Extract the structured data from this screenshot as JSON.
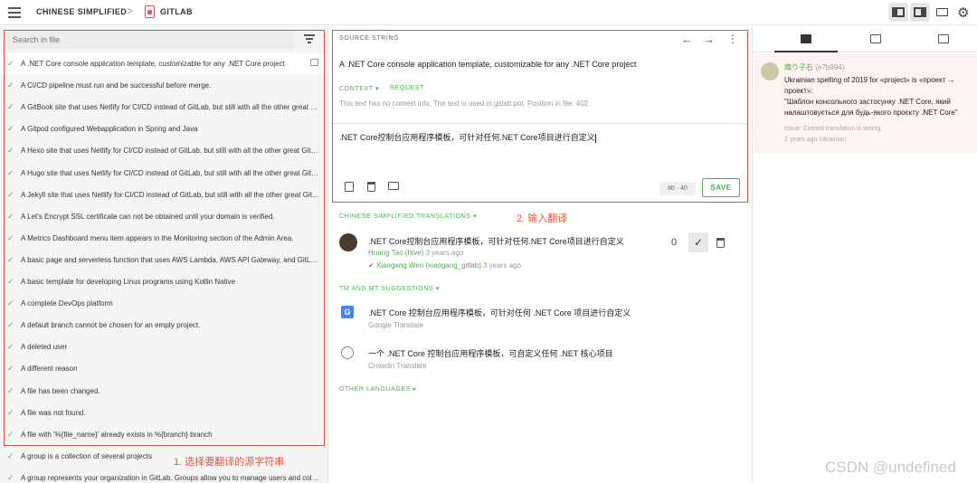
{
  "topbar": {
    "project": "CHINESE SIMPLIFIED",
    "separator": ">",
    "file": "GITLAB"
  },
  "left_panel": {
    "search_placeholder": "Search in file",
    "rows": [
      {
        "text": "A .NET Core console application template, customizable for any .NET Core project",
        "selected": true
      },
      {
        "text": "A CI/CD pipeline must run and be successful before merge."
      },
      {
        "text": "A GitBook site that uses Netlify for CI/CD instead of GitLab, but still with all the other great GitLab features."
      },
      {
        "text": "A Gitpod configured Webapplication in Spring and Java"
      },
      {
        "text": "A Hexo site that uses Netlify for CI/CD instead of GitLab, but still with all the other great GitLab features."
      },
      {
        "text": "A Hugo site that uses Netlify for CI/CD instead of GitLab, but still with all the other great GitLab features."
      },
      {
        "text": "A Jekyll site that uses Netlify for CI/CD instead of GitLab, but still with all the other great GitLab features."
      },
      {
        "text": "A Let's Encrypt SSL certificate can not be obtained until your domain is verified."
      },
      {
        "text": "A Metrics Dashboard menu item appears in the Monitoring section of the Admin Area."
      },
      {
        "text": "A basic page and serverless function that uses AWS Lambda, AWS API Gateway, and GitLab Pages"
      },
      {
        "text": "A basic template for developing Linux programs using Kotlin Native"
      },
      {
        "text": "A complete DevOps platform"
      },
      {
        "text": "A default branch cannot be chosen for an empty project."
      },
      {
        "text": "A deleted user"
      },
      {
        "text": "A different reason"
      },
      {
        "text": "A file has been changed."
      },
      {
        "text": "A file was not found."
      },
      {
        "text": "A file with '%{file_name}' already exists in %{branch} branch"
      },
      {
        "text": "A group is a collection of several projects"
      },
      {
        "text": "A group represents your organization in GitLab. Groups allow you to manage users and collaborate across multiple projects."
      }
    ],
    "annotation": "1. 选择要翻译的源字符串"
  },
  "source": {
    "label": "SOURCE STRING",
    "text": "A .NET Core console application template, customizable for any .NET Core project",
    "context_label": "CONTEXT",
    "request_label": "REQUEST",
    "context_info": "This text has no context info. The text is used in gitlab.pot. Position in file: 402"
  },
  "editor": {
    "translation": ".NET Core控制台应用程序模板，可针对任何.NET Core项目进行自定义",
    "counter": "80 · 40",
    "save_label": "SAVE"
  },
  "annotation2": "2. 输入翻译",
  "translations": {
    "label": "CHINESE SIMPLIFIED TRANSLATIONS",
    "item": {
      "text": ".NET Core控制台应用程序模板，可针对任何.NET Core项目进行自定义",
      "author": "Huang Tao (htve)",
      "author_time": "3 years ago",
      "approver": "Xiaogang Wen (xiaogang_gitlab)",
      "approver_time": "3 years ago",
      "votes": "0"
    }
  },
  "suggestions": {
    "label": "TM AND MT SUGGESTIONS",
    "items": [
      {
        "text": ".NET Core 控制台应用程序模板，可针对任何 .NET Core 项目进行自定义",
        "source": "Google Translate"
      },
      {
        "text": "一个 .NET Core 控制台应用程序模板，可自定义任何 .NET 核心项目",
        "source": "Crowdin Translate"
      }
    ]
  },
  "other_languages_label": "OTHER LANGUAGES",
  "issue": {
    "user": "織り子石",
    "hash": "(e7b994)",
    "text_line1": "Ukrainian spelling of 2019 for «project» is «проект → проект»:",
    "text_line2": "\"Шаблон консольного застосунку .NET Core, який налаштовується для будь-якого проєкту .NET Core\"",
    "issue_type": "Issue: Current translation is wrong",
    "meta": "2 years ago  Ukrainian"
  },
  "watermark": "CSDN @undefined",
  "colors": {
    "accent": "#4caf50",
    "annotation_red": "#e5533d"
  }
}
